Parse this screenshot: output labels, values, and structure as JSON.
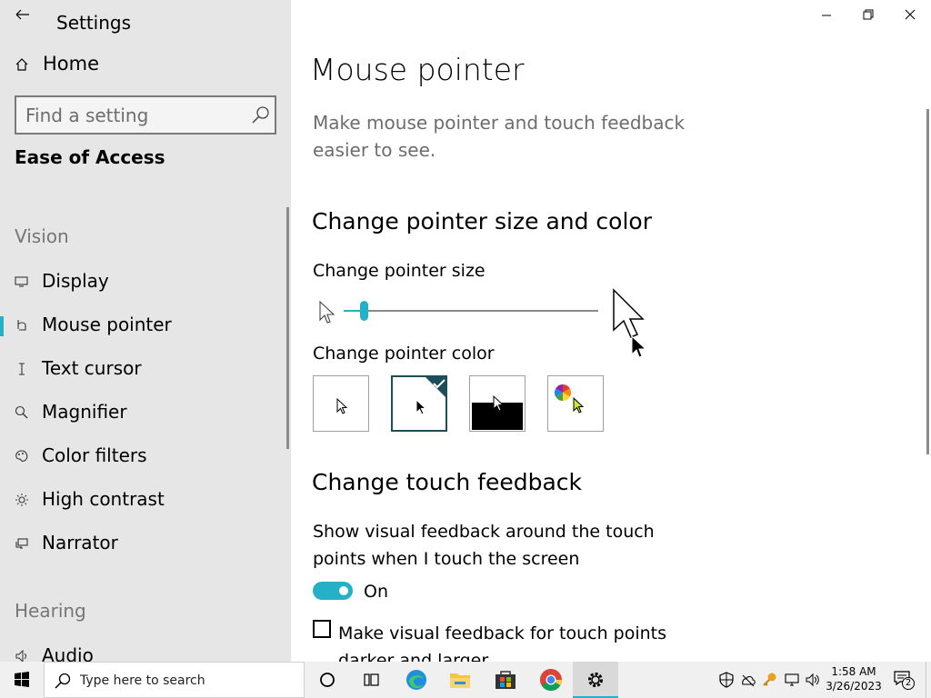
{
  "sidebar": {
    "title": "Settings",
    "home_label": "Home",
    "search_placeholder": "Find a setting",
    "category": "Ease of Access",
    "vision_label": "Vision",
    "items": [
      {
        "label": "Display",
        "icon": "display-icon"
      },
      {
        "label": "Mouse pointer",
        "icon": "mouse-pointer-icon",
        "selected": true
      },
      {
        "label": "Text cursor",
        "icon": "text-cursor-icon"
      },
      {
        "label": "Magnifier",
        "icon": "magnifier-icon"
      },
      {
        "label": "Color filters",
        "icon": "color-filters-icon"
      },
      {
        "label": "High contrast",
        "icon": "high-contrast-icon"
      },
      {
        "label": "Narrator",
        "icon": "narrator-icon"
      }
    ],
    "hearing_label": "Hearing",
    "hearing_items": [
      {
        "label": "Audio",
        "icon": "audio-icon"
      }
    ]
  },
  "main": {
    "page_title": "Mouse pointer",
    "description": "Make mouse pointer and touch feedback easier to see.",
    "size_color_heading": "Change pointer size and color",
    "pointer_size_label": "Change pointer size",
    "pointer_size_level": 1,
    "pointer_color_label": "Change pointer color",
    "pointer_color_options": [
      "white",
      "black",
      "inverted",
      "custom"
    ],
    "pointer_color_selected": "black",
    "touch_heading": "Change touch feedback",
    "touch_description": "Show visual feedback around the touch points when I touch the screen",
    "toggle_state": "On",
    "checkbox_label": "Make visual feedback for touch points darker and larger"
  },
  "taskbar": {
    "search_placeholder": "Type here to search",
    "time": "1:58 AM",
    "date": "3/26/2023",
    "notification_count": "2"
  },
  "colors": {
    "accent": "#26b0c8",
    "sidebar_bg": "#e6e6e6",
    "selected_bar": "#26b0c8",
    "check_badge": "#1c4d5a"
  }
}
